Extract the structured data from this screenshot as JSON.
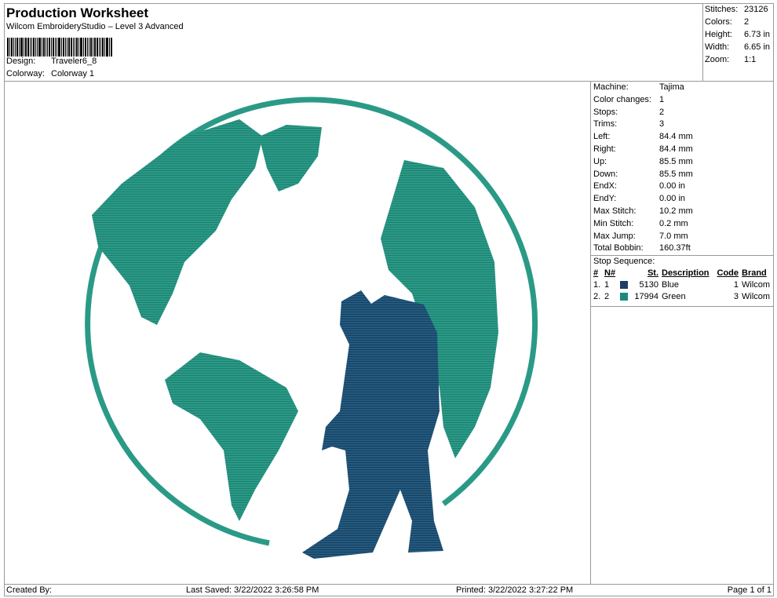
{
  "header": {
    "title": "Production Worksheet",
    "subtitle": "Wilcom EmbroideryStudio – Level 3 Advanced",
    "design_label": "Design:",
    "design": "Traveler6_8",
    "colorway_label": "Colorway:",
    "colorway": "Colorway 1"
  },
  "stats": [
    {
      "k": "Stitches:",
      "v": "23126"
    },
    {
      "k": "Colors:",
      "v": "2"
    },
    {
      "k": "Height:",
      "v": "6.73 in"
    },
    {
      "k": "Width:",
      "v": "6.65 in"
    },
    {
      "k": "Zoom:",
      "v": "1:1"
    }
  ],
  "props": [
    {
      "k": "Machine:",
      "v": "Tajima"
    },
    {
      "k": "Color changes:",
      "v": "1"
    },
    {
      "k": "Stops:",
      "v": "2"
    },
    {
      "k": "Trims:",
      "v": "3"
    },
    {
      "k": "Left:",
      "v": "84.4 mm"
    },
    {
      "k": "Right:",
      "v": "84.4 mm"
    },
    {
      "k": "Up:",
      "v": "85.5 mm"
    },
    {
      "k": "Down:",
      "v": "85.5 mm"
    },
    {
      "k": "EndX:",
      "v": "0.00 in"
    },
    {
      "k": "EndY:",
      "v": "0.00 in"
    },
    {
      "k": "Max Stitch:",
      "v": "10.2 mm"
    },
    {
      "k": "Min Stitch:",
      "v": "0.2 mm"
    },
    {
      "k": "Max Jump:",
      "v": "7.0 mm"
    },
    {
      "k": "Total Bobbin:",
      "v": "160.37ft"
    }
  ],
  "stop_sequence": {
    "title": "Stop Sequence:",
    "headers": [
      "#",
      "N#",
      "St.",
      "Description",
      "Code",
      "Brand"
    ],
    "rows": [
      {
        "idx": "1.",
        "n": "1",
        "color": "#1b3f66",
        "st": "5130",
        "desc": "Blue",
        "code": "1",
        "brand": "Wilcom"
      },
      {
        "idx": "2.",
        "n": "2",
        "color": "#1d8a7c",
        "st": "17994",
        "desc": "Green",
        "code": "3",
        "brand": "Wilcom"
      }
    ]
  },
  "colors": {
    "green": "#2a9a87",
    "blue": "#1f4f73"
  },
  "footer": {
    "created": "Created By:",
    "saved": "Last Saved: 3/22/2022 3:26:58 PM",
    "printed": "Printed: 3/22/2022 3:27:22 PM",
    "page": "Page 1 of 1"
  }
}
